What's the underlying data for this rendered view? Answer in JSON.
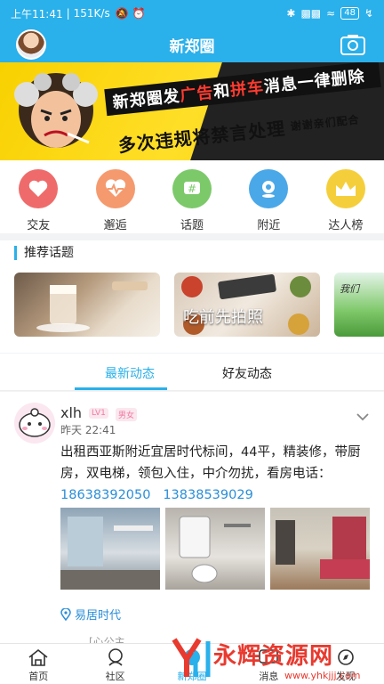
{
  "status_bar": {
    "time": "上午11:41",
    "speed": "151K/s",
    "battery": "48"
  },
  "header": {
    "title": "新郑圈"
  },
  "banner": {
    "line1_a": "新郑圈发",
    "line1_b": "广告",
    "line1_c": "和",
    "line1_d": "拼车",
    "line1_e": "消息一律删除",
    "line2_a": "多次违规将禁言处理",
    "line2_b": "谢谢亲们配合"
  },
  "categories": [
    {
      "label": "交友",
      "color": "#ef6b6b",
      "icon": "heart-icon"
    },
    {
      "label": "邂逅",
      "color": "#f59a6e",
      "icon": "pulse-icon"
    },
    {
      "label": "话题",
      "color": "#7cc96a",
      "icon": "hashtag-icon"
    },
    {
      "label": "附近",
      "color": "#4aa8e8",
      "icon": "location-icon"
    },
    {
      "label": "达人榜",
      "color": "#f5cf3b",
      "icon": "crown-icon"
    }
  ],
  "recommended": {
    "heading": "推荐话题",
    "item2_text": "吃前先拍照",
    "item3_text": "我们"
  },
  "feed_tabs": [
    {
      "label": "最新动态"
    },
    {
      "label": "好友动态"
    }
  ],
  "post": {
    "username": "xlh",
    "level": "LV1",
    "gender": "男女",
    "time": "昨天 22:41",
    "text": "出租西亚斯附近宜居时代标间，44平，精装修，带厨房，双电梯，领包入住，中介勿扰，看房电话：",
    "phone1": "18638392050",
    "phone2": "13838539029",
    "location": "易居时代"
  },
  "bottom_nav": [
    {
      "label": "首页",
      "icon": "home-icon"
    },
    {
      "label": "社区",
      "icon": "community-icon"
    },
    {
      "label": "新郑圈",
      "icon": "center-icon"
    },
    {
      "label": "消息",
      "icon": "message-icon"
    },
    {
      "label": "发现",
      "icon": "discover-icon"
    }
  ],
  "partial_hint": "[心公主",
  "watermark": {
    "brand": "永辉资源网",
    "url": "www.yhkjjj.com"
  },
  "colors": {
    "accent": "#2ab0ea",
    "link": "#2a8ed8",
    "banner_yellow": "#f8d100",
    "watermark_red": "#e83a2f"
  }
}
